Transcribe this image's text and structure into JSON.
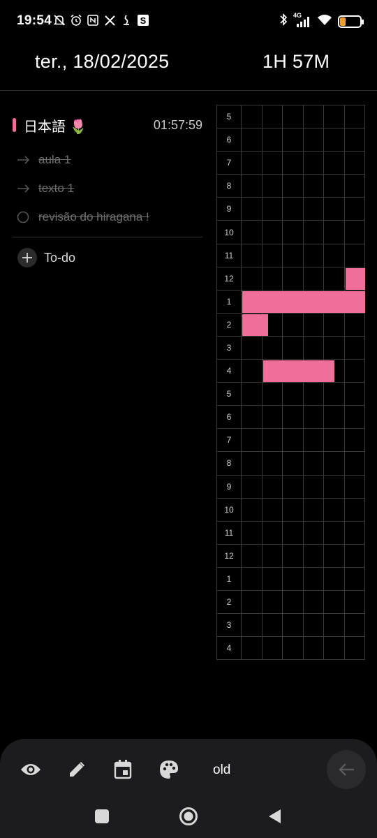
{
  "status_bar": {
    "time": "19:54",
    "left_icons": [
      "mute-icon",
      "alarm-icon",
      "nfc-icon",
      "x-icon",
      "notification-icon",
      "s-app-icon"
    ],
    "right_icons": [
      "bluetooth-icon",
      "signal-4g-icon",
      "wifi-icon"
    ],
    "network_label": "4G",
    "battery_level": "34"
  },
  "header": {
    "date": "ter., 18/02/2025",
    "duration": "1H 57M"
  },
  "task": {
    "title": "日本語 🌷",
    "elapsed": "01:57:59",
    "color": "#f06f9a",
    "subtasks": [
      {
        "label": "aula 1",
        "state": "arrow",
        "done": true
      },
      {
        "label": "texto 1",
        "state": "arrow",
        "done": true
      },
      {
        "label": "revisão do hiragana !",
        "state": "circle",
        "done": true
      }
    ],
    "add_label": "To-do"
  },
  "timeline": {
    "hour_labels": [
      "5",
      "6",
      "7",
      "8",
      "9",
      "10",
      "11",
      "12",
      "1",
      "2",
      "3",
      "4",
      "5",
      "6",
      "7",
      "8",
      "9",
      "10",
      "11",
      "12",
      "1",
      "2",
      "3",
      "4"
    ],
    "columns": 6,
    "filled_color": "#f06f9a",
    "filled_segments": [
      {
        "row": 7,
        "from": 5.0,
        "to": 6.0
      },
      {
        "row": 8,
        "from": 0.0,
        "to": 6.0
      },
      {
        "row": 9,
        "from": 0.0,
        "to": 1.3
      },
      {
        "row": 11,
        "from": 1.0,
        "to": 4.5
      }
    ]
  },
  "toolbar": {
    "icons": [
      "eye-icon",
      "pencil-icon",
      "calendar-icon",
      "palette-icon"
    ],
    "mode_label": "old",
    "back_icon": "arrow-left-icon"
  },
  "navbar": {
    "buttons": [
      "recents-button",
      "home-button",
      "back-button"
    ]
  }
}
